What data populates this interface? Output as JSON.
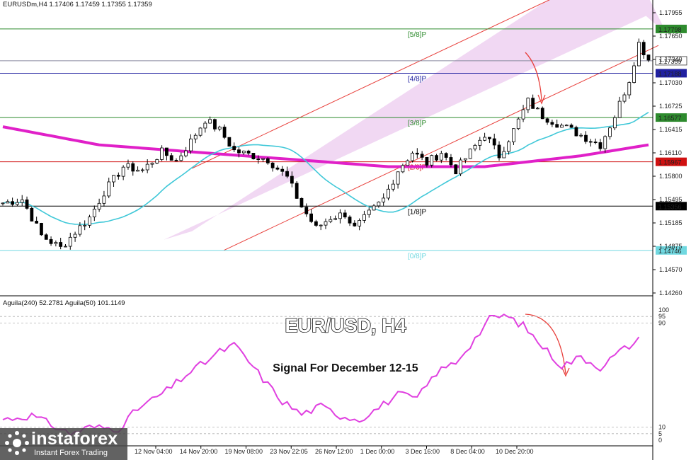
{
  "header": {
    "symbol_info": "EURUSDm,H4  1.17406 1.17459 1.17355 1.17359",
    "indicator_info": "Aguila(240) 52.2781  Aguila(50) 101.1149"
  },
  "annotations": {
    "title": "EUR/USD, H4",
    "signal": "Signal For December 12-15"
  },
  "brand": {
    "name": "instaforex",
    "tagline": "Instant Forex Trading"
  },
  "colors": {
    "channel_fill": "#f0d4f2",
    "channel_line": "#e8403c",
    "ema200": "#e020c8",
    "sma21": "#40c8d8",
    "oscillator": "#e040e0",
    "level_green": "#2e8b2e",
    "level_blue": "#2020a0",
    "level_red": "#d01010",
    "level_black": "#000000",
    "level_cyan": "#70d8e0"
  },
  "chart_data": {
    "type": "candlestick",
    "ylim": [
      1.1412,
      1.1808
    ],
    "price_ticks": [
      "1.17955",
      "1.17650",
      "1.17340",
      "1.17030",
      "1.16725",
      "1.16415",
      "1.16110",
      "1.15800",
      "1.15495",
      "1.15185",
      "1.14875",
      "1.14570",
      "1.14260"
    ],
    "time_ticks": [
      "12 Nov 04:00",
      "14 Nov 20:00",
      "19 Nov 08:00",
      "23 Nov 22:05",
      "26 Nov 12:00",
      "1 Dec 00:00",
      "3 Dec 16:00",
      "8 Dec 04:00",
      "10 Dec 20:00"
    ],
    "murrey_levels": [
      {
        "label": "[5/8]P",
        "value": 1.17798,
        "price_tag": "1.17798",
        "color": "#2e8b2e"
      },
      {
        "label": "[4/8]P",
        "value": 1.17188,
        "price_tag": "1.17188",
        "color": "#2020a0"
      },
      {
        "label": "[3/8]P",
        "value": 1.16577,
        "price_tag": "1.16577",
        "color": "#2e8b2e"
      },
      {
        "label": "[2/8]P",
        "value": 1.15967,
        "price_tag": "1.15967",
        "color": "#d01010"
      },
      {
        "label": "[1/8]P",
        "value": 1.15356,
        "price_tag": "1.15356",
        "color": "#000000"
      },
      {
        "label": "[0/8]P",
        "value": 1.14746,
        "price_tag": "1.14746",
        "color": "#70d8e0"
      }
    ],
    "current_price": {
      "value": 1.17359,
      "tag": "1.17359"
    },
    "channel": {
      "start": {
        "candle": 40,
        "price": 1.151
      },
      "end": {
        "candle": 132,
        "price": 1.1798
      },
      "width_price": 0.008
    },
    "waypoints": [
      [
        0,
        1.154
      ],
      [
        4,
        1.1545
      ],
      [
        8,
        1.1495
      ],
      [
        12,
        1.1478
      ],
      [
        15,
        1.15
      ],
      [
        18,
        1.152
      ],
      [
        21,
        1.1555
      ],
      [
        25,
        1.159
      ],
      [
        29,
        1.1585
      ],
      [
        33,
        1.161
      ],
      [
        36,
        1.1598
      ],
      [
        39,
        1.1625
      ],
      [
        42,
        1.1655
      ],
      [
        45,
        1.164
      ],
      [
        48,
        1.1612
      ],
      [
        52,
        1.1605
      ],
      [
        55,
        1.16
      ],
      [
        59,
        1.1575
      ],
      [
        62,
        1.1535
      ],
      [
        65,
        1.1505
      ],
      [
        68,
        1.152
      ],
      [
        71,
        1.1525
      ],
      [
        73,
        1.1505
      ],
      [
        76,
        1.1525
      ],
      [
        79,
        1.1545
      ],
      [
        82,
        1.1585
      ],
      [
        85,
        1.161
      ],
      [
        88,
        1.1595
      ],
      [
        91,
        1.161
      ],
      [
        94,
        1.1585
      ],
      [
        97,
        1.161
      ],
      [
        100,
        1.1635
      ],
      [
        103,
        1.1605
      ],
      [
        106,
        1.164
      ],
      [
        109,
        1.168
      ],
      [
        112,
        1.166
      ],
      [
        115,
        1.165
      ],
      [
        118,
        1.164
      ],
      [
        121,
        1.163
      ],
      [
        124,
        1.162
      ],
      [
        127,
        1.166
      ],
      [
        130,
        1.171
      ],
      [
        132,
        1.176
      ],
      [
        134,
        1.1738
      ]
    ],
    "ema200_points": [
      [
        0,
        1.1645
      ],
      [
        20,
        1.162
      ],
      [
        40,
        1.161
      ],
      [
        60,
        1.16
      ],
      [
        80,
        1.159
      ],
      [
        100,
        1.159
      ],
      [
        120,
        1.1605
      ],
      [
        134,
        1.162
      ]
    ],
    "projection_arrow": "down",
    "oscillator": {
      "ylim": [
        0,
        100
      ],
      "ticks": [
        "100",
        "95",
        "90",
        "10",
        "5",
        "0"
      ],
      "level_lines": [
        95,
        90,
        10,
        5
      ],
      "points": [
        [
          0,
          16
        ],
        [
          6,
          19
        ],
        [
          10,
          12
        ],
        [
          14,
          5
        ],
        [
          18,
          10
        ],
        [
          24,
          9
        ],
        [
          28,
          24
        ],
        [
          34,
          38
        ],
        [
          38,
          50
        ],
        [
          42,
          60
        ],
        [
          45,
          68
        ],
        [
          48,
          73
        ],
        [
          50,
          65
        ],
        [
          54,
          47
        ],
        [
          58,
          30
        ],
        [
          62,
          20
        ],
        [
          66,
          26
        ],
        [
          70,
          19
        ],
        [
          74,
          16
        ],
        [
          78,
          25
        ],
        [
          82,
          35
        ],
        [
          86,
          32
        ],
        [
          90,
          52
        ],
        [
          94,
          60
        ],
        [
          98,
          78
        ],
        [
          101,
          93
        ],
        [
          104,
          96
        ],
        [
          108,
          88
        ],
        [
          112,
          72
        ],
        [
          116,
          57
        ],
        [
          120,
          64
        ],
        [
          124,
          56
        ],
        [
          128,
          68
        ],
        [
          132,
          77
        ]
      ]
    }
  }
}
